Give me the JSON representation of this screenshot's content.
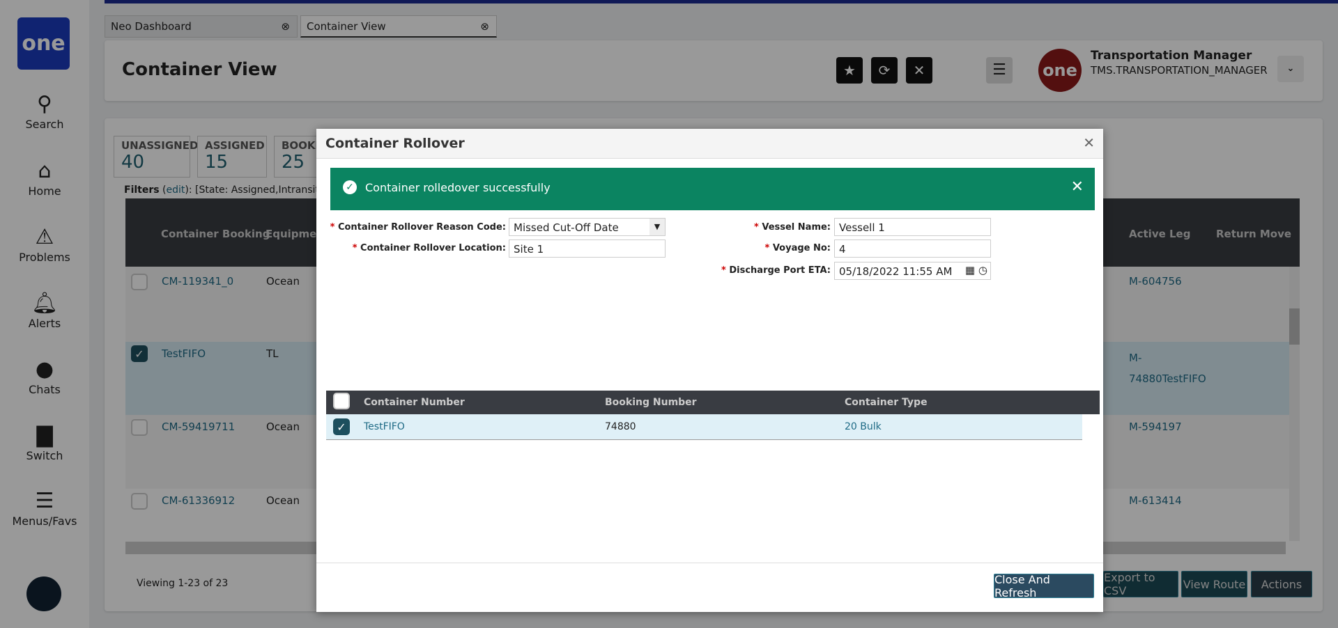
{
  "sidebar": {
    "logo": "one",
    "items": [
      {
        "label": "Search",
        "icon": "search-icon"
      },
      {
        "label": "Home",
        "icon": "home-icon"
      },
      {
        "label": "Problems",
        "icon": "warning-icon"
      },
      {
        "label": "Alerts",
        "icon": "bell-icon"
      },
      {
        "label": "Chats",
        "icon": "chat-icon"
      },
      {
        "label": "Switch",
        "icon": "switch-icon"
      },
      {
        "label": "Menus/Favs",
        "icon": "menu-icon"
      }
    ]
  },
  "tabs": [
    {
      "label": "Neo Dashboard"
    },
    {
      "label": "Container View"
    }
  ],
  "header": {
    "title": "Container View",
    "user_name": "Transportation Manager",
    "user_role": "TMS.TRANSPORTATION_MANAGER",
    "avatar": "one"
  },
  "kpis": [
    {
      "label": "UNASSIGNED",
      "value": "40"
    },
    {
      "label": "ASSIGNED",
      "value": "15"
    },
    {
      "label": "BOOKED",
      "value": "25"
    }
  ],
  "filters": {
    "label": "Filters",
    "edit": "edit",
    "value": "[State: Assigned,Intransit]"
  },
  "grid": {
    "columns": [
      "Container Booking",
      "Equipment",
      "Active Leg",
      "Return Move"
    ],
    "rows": [
      {
        "booking": "CM-119341_0",
        "equipment": "Ocean",
        "active_leg": "M-604756",
        "checked": false
      },
      {
        "booking": "TestFIFO",
        "equipment": "TL",
        "active_leg": "M-74880TestFIFO",
        "checked": true
      },
      {
        "booking": "CM-59419711",
        "equipment": "Ocean",
        "active_leg": "M-594197",
        "checked": false
      },
      {
        "booking": "CM-61336912",
        "equipment": "Ocean",
        "active_leg": "M-613414",
        "checked": false
      }
    ],
    "viewing": "Viewing 1-23 of 23"
  },
  "footer_buttons": {
    "export": "Export to CSV",
    "view_route": "View Route",
    "actions": "Actions"
  },
  "modal": {
    "title": "Container Rollover",
    "success": "Container rolledover successfully",
    "fields": {
      "reason_label": "Container Rollover Reason Code:",
      "reason_value": "Missed Cut-Off Date",
      "location_label": "Container Rollover Location:",
      "location_value": "Site 1",
      "vessel_label": "Vessel Name:",
      "vessel_value": "Vessell 1",
      "voyage_label": "Voyage No:",
      "voyage_value": "4",
      "eta_label": "Discharge Port ETA:",
      "eta_value": "05/18/2022 11:55 AM"
    },
    "grid": {
      "columns": [
        "Container Number",
        "Booking Number",
        "Container Type"
      ],
      "rows": [
        {
          "container": "TestFIFO",
          "booking": "74880",
          "type": "20 Bulk"
        }
      ]
    },
    "close_refresh": "Close And Refresh"
  }
}
